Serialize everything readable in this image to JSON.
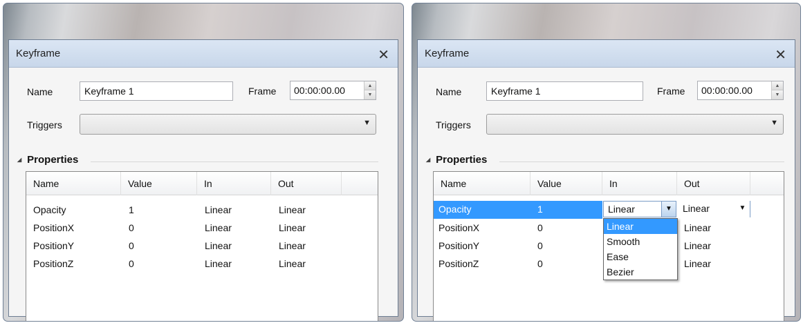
{
  "left_dialog": {
    "title": "Keyframe",
    "close_glyph": "✕",
    "name_label": "Name",
    "name_value": "Keyframe 1",
    "frame_label": "Frame",
    "frame_value": "00:00:00.00",
    "triggers_label": "Triggers",
    "triggers_value": "",
    "section_label": "Properties",
    "columns": [
      "Name",
      "Value",
      "In",
      "Out"
    ],
    "rows": [
      {
        "name": "Opacity",
        "value": "1",
        "in": "Linear",
        "out": "Linear"
      },
      {
        "name": "PositionX",
        "value": "0",
        "in": "Linear",
        "out": "Linear"
      },
      {
        "name": "PositionY",
        "value": "0",
        "in": "Linear",
        "out": "Linear"
      },
      {
        "name": "PositionZ",
        "value": "0",
        "in": "Linear",
        "out": "Linear"
      }
    ]
  },
  "right_dialog": {
    "title": "Keyframe",
    "close_glyph": "✕",
    "name_label": "Name",
    "name_value": "Keyframe 1",
    "frame_label": "Frame",
    "frame_value": "00:00:00.00",
    "triggers_label": "Triggers",
    "triggers_value": "",
    "section_label": "Properties",
    "columns": [
      "Name",
      "Value",
      "In",
      "Out"
    ],
    "rows": [
      {
        "name": "Opacity",
        "value": "1",
        "in": "Linear",
        "out": "Linear"
      },
      {
        "name": "PositionX",
        "value": "0",
        "in": "",
        "out": "Linear"
      },
      {
        "name": "PositionY",
        "value": "0",
        "in": "",
        "out": "Linear"
      },
      {
        "name": "PositionZ",
        "value": "0",
        "in": "",
        "out": "Linear"
      }
    ],
    "in_dropdown_options": [
      "Linear",
      "Smooth",
      "Ease",
      "Bezier"
    ],
    "in_dropdown_highlighted": "Linear"
  },
  "colors": {
    "selection": "#3399ff",
    "titlebar": "#c8d7ea"
  },
  "icons": {
    "close": "close-icon",
    "spin_up": "spin-up-icon",
    "spin_down": "spin-down-icon",
    "dropdown": "chevron-down-icon",
    "collapse": "collapse-triangle-icon"
  }
}
